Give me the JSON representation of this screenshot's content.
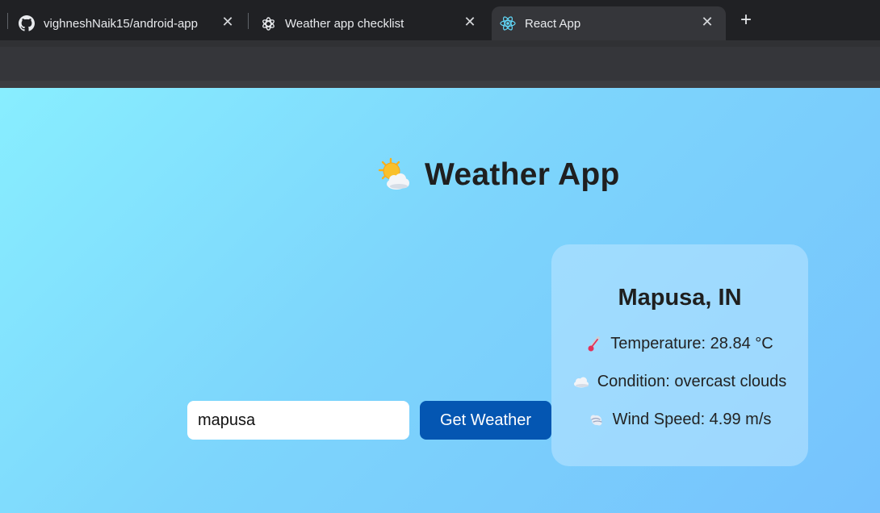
{
  "browser": {
    "tabs": [
      {
        "title": "vighneshNaik15/android-app",
        "icon": "github-icon"
      },
      {
        "title": "Weather app checklist",
        "icon": "chatgpt-icon"
      },
      {
        "title": "React App",
        "icon": "react-icon",
        "active": true
      }
    ],
    "close_glyph": "✕",
    "new_tab_glyph": "+"
  },
  "app": {
    "title": "Weather App",
    "title_icon": "sun-behind-cloud-icon",
    "search": {
      "value": "mapusa",
      "button_label": "Get Weather"
    },
    "result": {
      "location": "Mapusa, IN",
      "temperature": "Temperature: 28.84 °C",
      "condition": "Condition: overcast clouds",
      "wind": "Wind Speed: 4.99 m/s"
    }
  },
  "colors": {
    "button": "#0456b2",
    "page_gradient_start": "#88eeff",
    "page_gradient_end": "#76c2fd"
  }
}
